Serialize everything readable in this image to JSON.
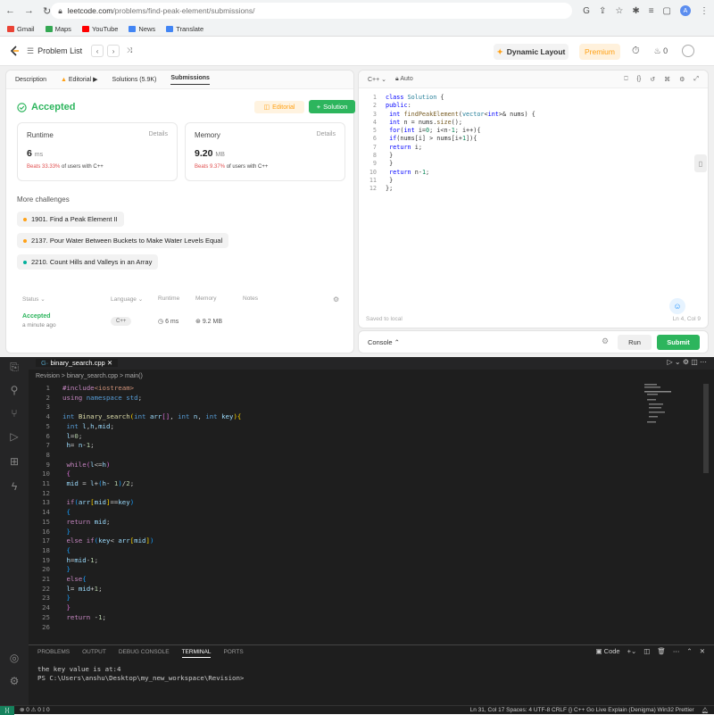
{
  "browser": {
    "url_domain": "leetcode.com",
    "url_path": "/problems/find-peak-element/submissions/",
    "avatar_letter": "A",
    "bookmarks": [
      {
        "label": "Gmail",
        "color": "#ea4335"
      },
      {
        "label": "Maps",
        "color": "#34a853"
      },
      {
        "label": "YouTube",
        "color": "#ff0000"
      },
      {
        "label": "News",
        "color": "#4285f4"
      },
      {
        "label": "Translate",
        "color": "#4285f4"
      }
    ]
  },
  "lc_nav": {
    "problem_list": "Problem List",
    "dynamic_layout": "Dynamic Layout",
    "premium": "Premium",
    "points": "0"
  },
  "left_panel": {
    "tabs": [
      "Description",
      "Editorial",
      "Solutions (5.9K)",
      "Submissions"
    ],
    "status": "Accepted",
    "editorial_btn": "Editorial",
    "solution_btn": "Solution",
    "runtime": {
      "label": "Runtime",
      "details": "Details",
      "value": "6",
      "unit": "ms",
      "beats_pct": "Beats 33.33%",
      "beats_rest": "of users with C++"
    },
    "memory": {
      "label": "Memory",
      "details": "Details",
      "value": "9.20",
      "unit": "MB",
      "beats_pct": "Beats 9.37%",
      "beats_rest": "of users with C++"
    },
    "more_challenges": "More challenges",
    "challenges": [
      {
        "label": "1901. Find a Peak Element II",
        "color": "#ffa116"
      },
      {
        "label": "2137. Pour Water Between Buckets to Make Water Levels Equal",
        "color": "#ffa116"
      },
      {
        "label": "2210. Count Hills and Valleys in an Array",
        "color": "#00af9b"
      }
    ],
    "sub_headers": [
      "Status",
      "Language",
      "Runtime",
      "Memory",
      "Notes"
    ],
    "sub_row": {
      "status": "Accepted",
      "time": "a minute ago",
      "language": "C++",
      "runtime": "6 ms",
      "memory": "9.2 MB"
    }
  },
  "code_panel": {
    "language": "C++",
    "mode": "Auto",
    "saved": "Saved to local",
    "cursor": "Ln 4, Col 9",
    "console": "Console",
    "run": "Run",
    "submit": "Submit"
  },
  "vscode": {
    "tab_name": "binary_search.cpp",
    "breadcrumb": "Revision > binary_search.cpp > main()",
    "terminal_tabs": [
      "PROBLEMS",
      "OUTPUT",
      "DEBUG CONSOLE",
      "TERMINAL",
      "PORTS"
    ],
    "terminal_shell": "Code",
    "terminal_lines": [
      "the key value is at:4",
      "PS C:\\Users\\anshu\\Desktop\\my_new_workspace\\Revision>"
    ],
    "status_left": "⊗ 0 ⚠ 0   ⟟ 0",
    "status_right": "Ln 31, Col 17   Spaces: 4   UTF-8   CRLF   {} C++   Go Live   Explain (Denigma)   Win32   Prettier"
  }
}
